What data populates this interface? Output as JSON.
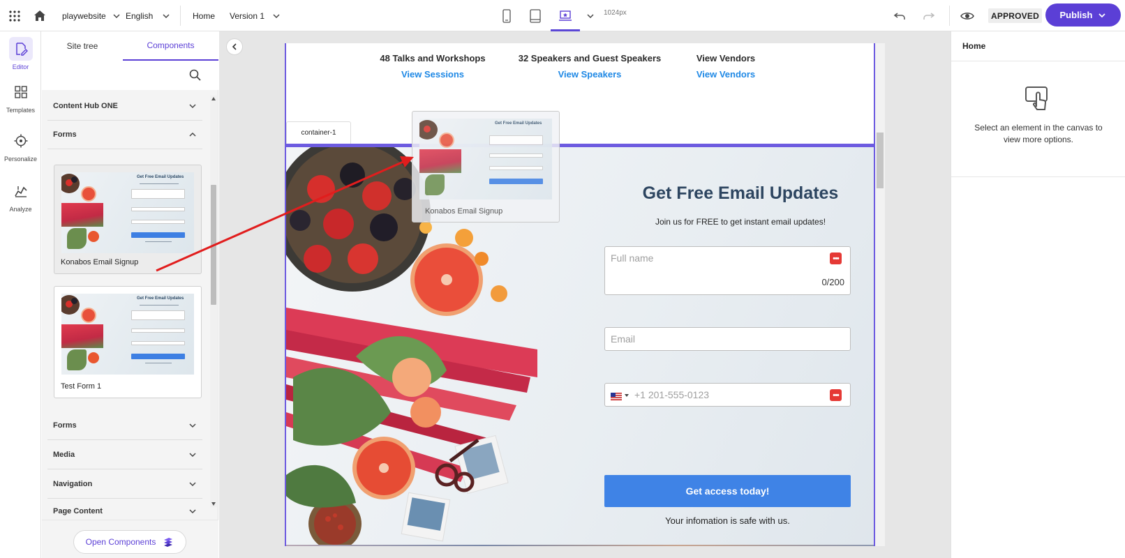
{
  "topbar": {
    "site": "playwebsite",
    "language": "English",
    "page": "Home",
    "version": "Version 1",
    "viewport": "1024px",
    "status": "APPROVED",
    "publish": "Publish"
  },
  "rail": {
    "items": [
      {
        "label": "Editor",
        "icon": "edit-page-icon",
        "active": true
      },
      {
        "label": "Templates",
        "icon": "grid-icon"
      },
      {
        "label": "Personalize",
        "icon": "target-icon"
      },
      {
        "label": "Analyze",
        "icon": "chart-icon"
      }
    ]
  },
  "left_panel": {
    "tabs": [
      "Site tree",
      "Components"
    ],
    "sections": {
      "content_hub": "Content Hub ONE",
      "forms_open": "Forms",
      "forms": "Forms",
      "media": "Media",
      "navigation": "Navigation",
      "page_content": "Page Content"
    },
    "cards": [
      {
        "label": "Konabos Email Signup"
      },
      {
        "label": "Test Form 1"
      }
    ],
    "open_components": "Open Components"
  },
  "canvas": {
    "stats": [
      {
        "title": "48 Talks and Workshops",
        "link": "View Sessions"
      },
      {
        "title": "32 Speakers and Guest Speakers",
        "link": "View Speakers"
      },
      {
        "title": "View Vendors",
        "link": "View Vendors"
      }
    ],
    "container_label": "container-1",
    "hero": {
      "title": "Get Free Email Updates",
      "subtitle": "Join us for FREE to get instant email updates!",
      "full_name_placeholder": "Full name",
      "counter": "0/200",
      "email_placeholder": "Email",
      "phone_placeholder": "+1 201-555-0123",
      "cta": "Get access today!",
      "safe_note": "Your infomation is safe with us."
    },
    "drag_ghost_label": "Konabos Email Signup"
  },
  "right_panel": {
    "title": "Home",
    "message": "Select an element in the canvas to view more options."
  },
  "colors": {
    "accent": "#5b3fd6",
    "link_blue": "#1e88e5",
    "cta_blue": "#3f83e6",
    "arrow_red": "#e11d1d"
  }
}
